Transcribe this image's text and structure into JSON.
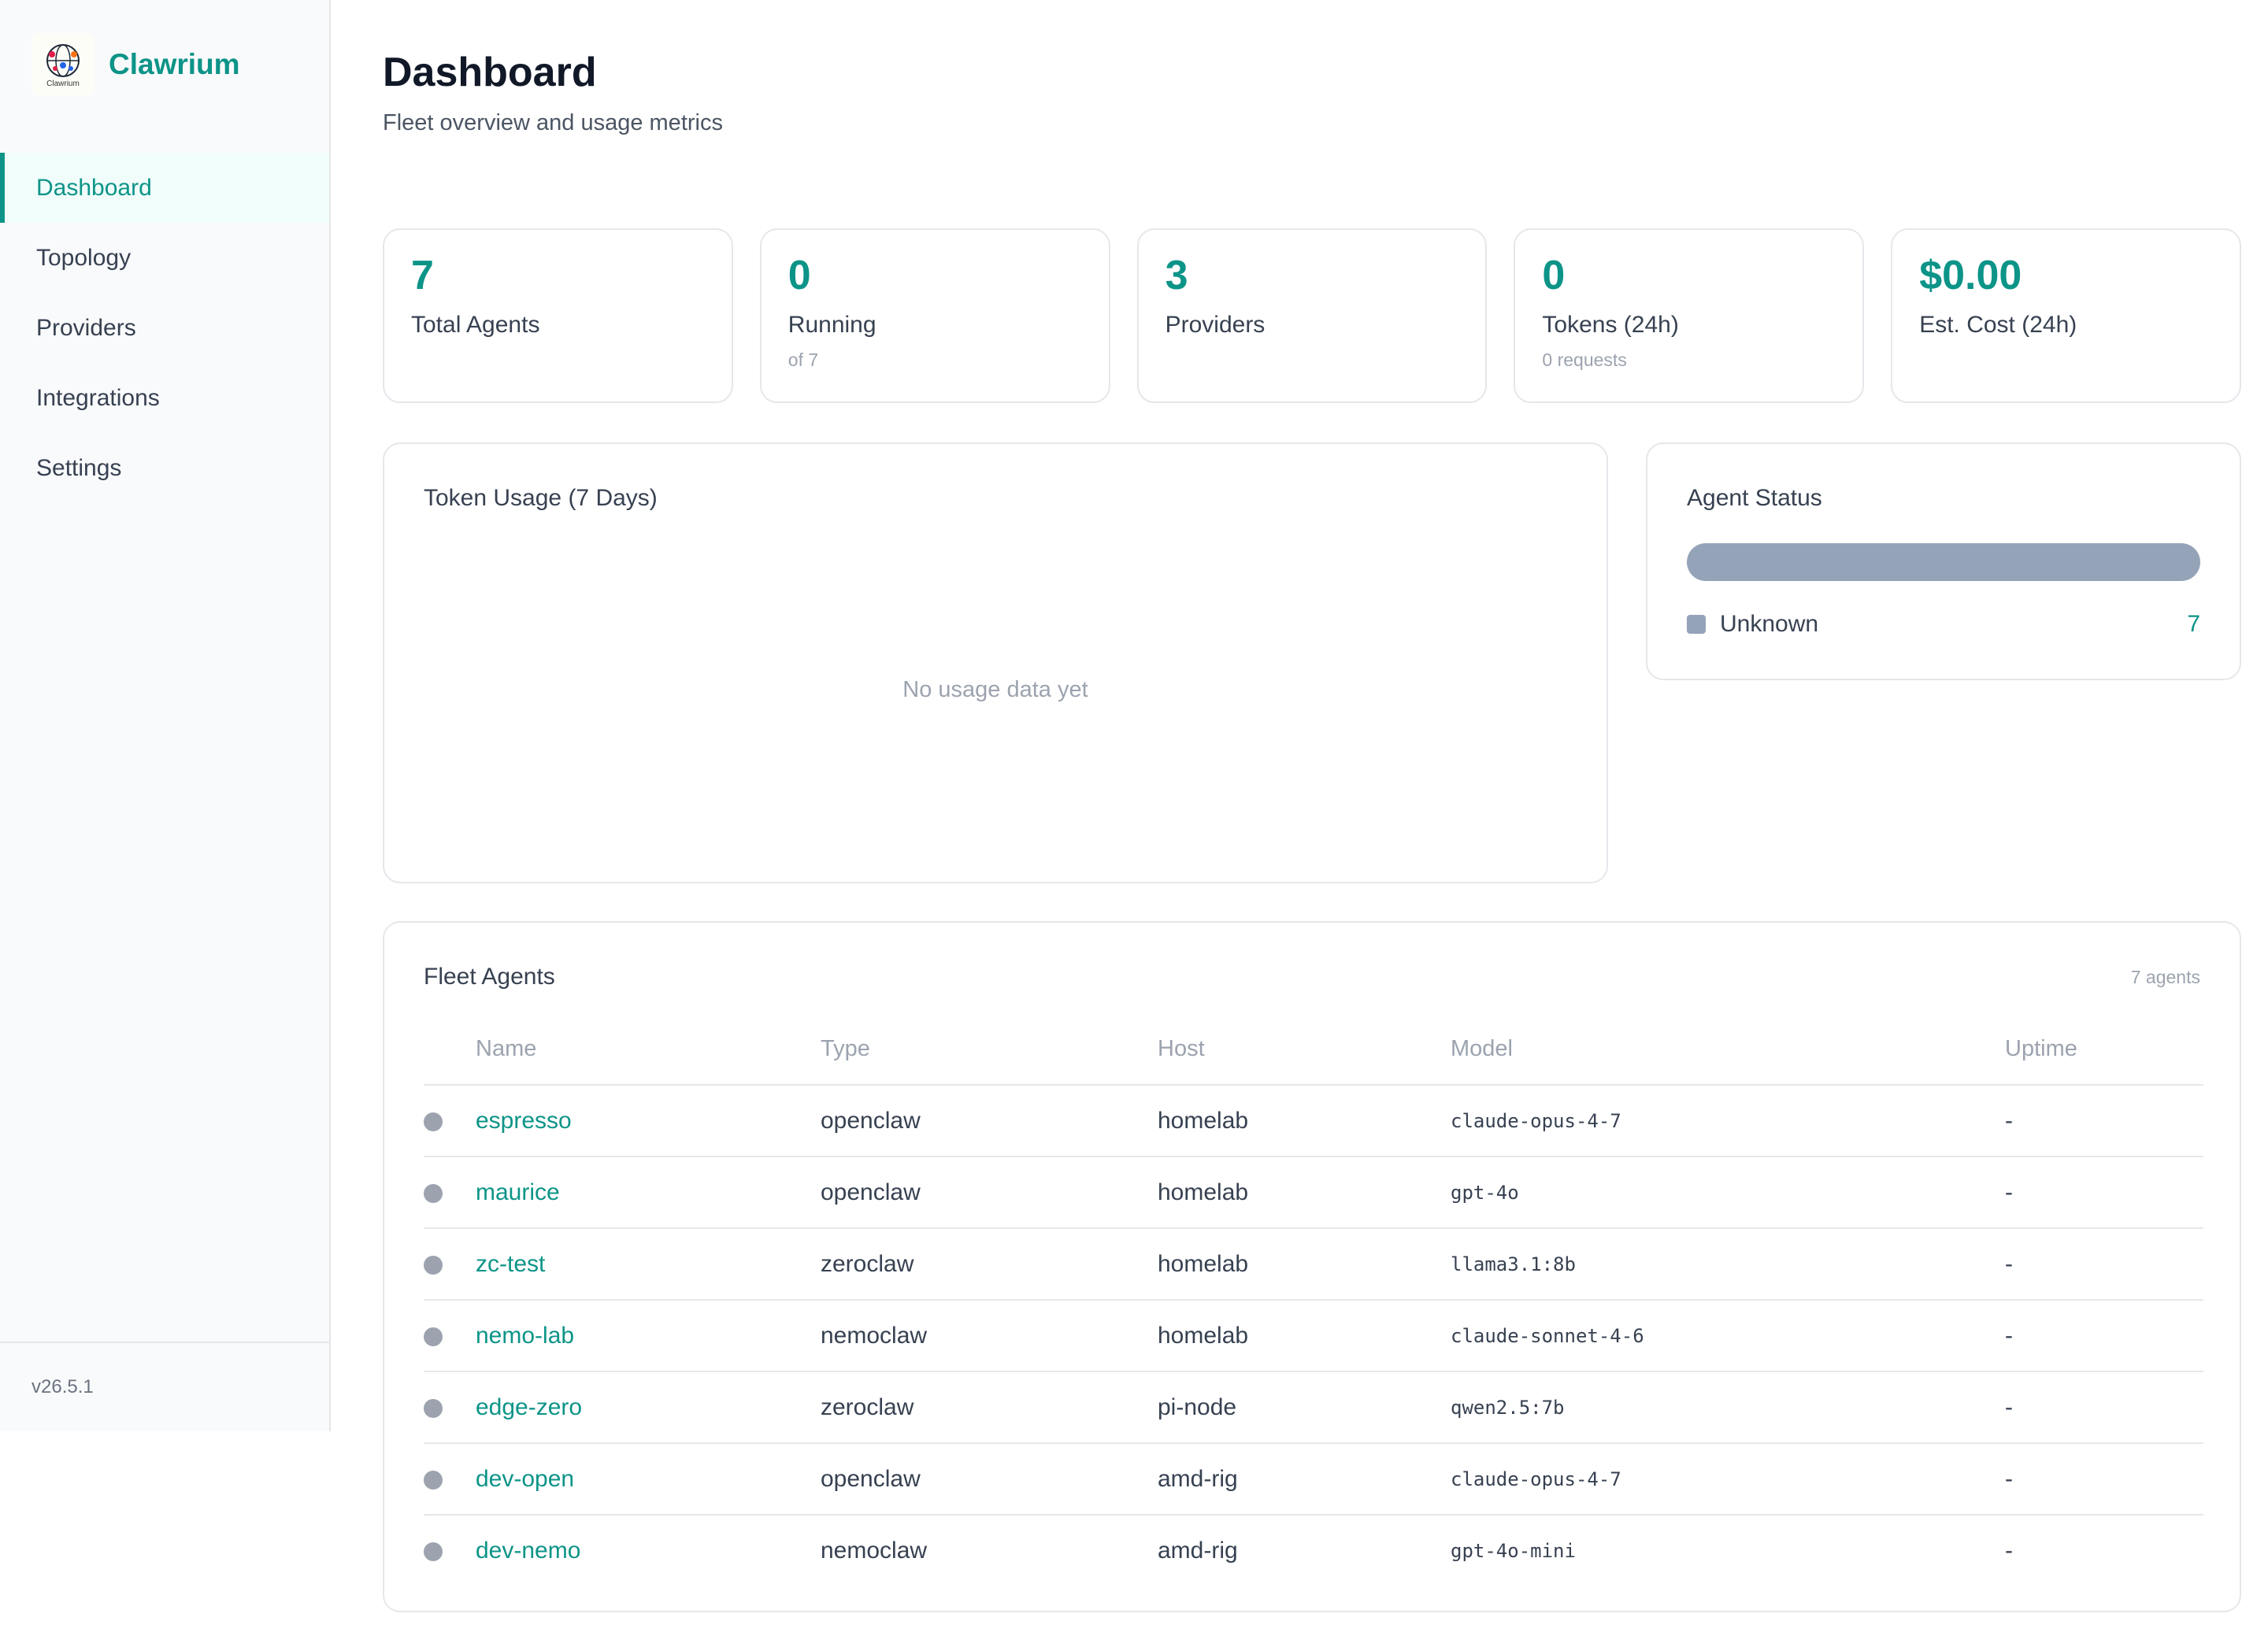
{
  "app": {
    "name": "Clawrium",
    "logo_text": "Clawrium",
    "version": "v26.5.1"
  },
  "nav": [
    {
      "label": "Dashboard",
      "active": true
    },
    {
      "label": "Topology",
      "active": false
    },
    {
      "label": "Providers",
      "active": false
    },
    {
      "label": "Integrations",
      "active": false
    },
    {
      "label": "Settings",
      "active": false
    }
  ],
  "page": {
    "title": "Dashboard",
    "subtitle": "Fleet overview and usage metrics"
  },
  "stats": [
    {
      "value": "7",
      "label": "Total Agents",
      "sub": ""
    },
    {
      "value": "0",
      "label": "Running",
      "sub": "of 7"
    },
    {
      "value": "3",
      "label": "Providers",
      "sub": ""
    },
    {
      "value": "0",
      "label": "Tokens (24h)",
      "sub": "0 requests"
    },
    {
      "value": "$0.00",
      "label": "Est. Cost (24h)",
      "sub": ""
    }
  ],
  "usage": {
    "title": "Token Usage (7 Days)",
    "empty_text": "No usage data yet"
  },
  "agent_status": {
    "title": "Agent Status",
    "items": [
      {
        "label": "Unknown",
        "count": "7",
        "color": "#94a3b8"
      }
    ]
  },
  "fleet": {
    "title": "Fleet Agents",
    "count_text": "7 agents",
    "columns": {
      "name": "Name",
      "type": "Type",
      "host": "Host",
      "model": "Model",
      "uptime": "Uptime"
    },
    "rows": [
      {
        "name": "espresso",
        "type": "openclaw",
        "host": "homelab",
        "model": "claude-opus-4-7",
        "uptime": "-"
      },
      {
        "name": "maurice",
        "type": "openclaw",
        "host": "homelab",
        "model": "gpt-4o",
        "uptime": "-"
      },
      {
        "name": "zc-test",
        "type": "zeroclaw",
        "host": "homelab",
        "model": "llama3.1:8b",
        "uptime": "-"
      },
      {
        "name": "nemo-lab",
        "type": "nemoclaw",
        "host": "homelab",
        "model": "claude-sonnet-4-6",
        "uptime": "-"
      },
      {
        "name": "edge-zero",
        "type": "zeroclaw",
        "host": "pi-node",
        "model": "qwen2.5:7b",
        "uptime": "-"
      },
      {
        "name": "dev-open",
        "type": "openclaw",
        "host": "amd-rig",
        "model": "claude-opus-4-7",
        "uptime": "-"
      },
      {
        "name": "dev-nemo",
        "type": "nemoclaw",
        "host": "amd-rig",
        "model": "gpt-4o-mini",
        "uptime": "-"
      }
    ]
  },
  "colors": {
    "accent": "#0d9488",
    "status_unknown": "#94a3b8"
  }
}
